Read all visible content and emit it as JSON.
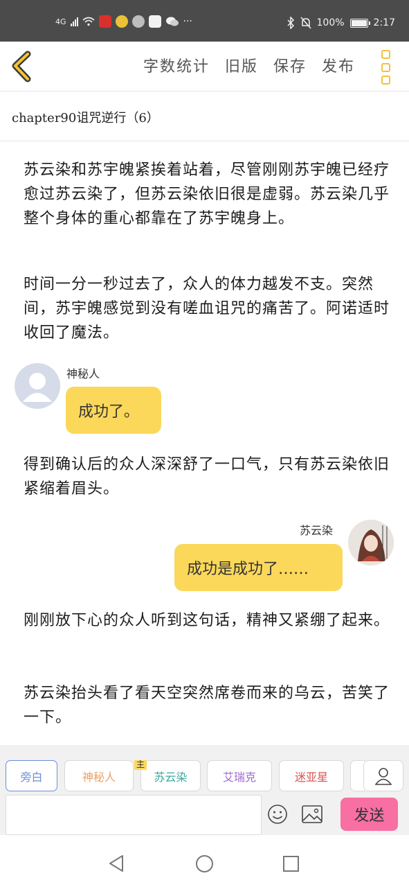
{
  "status_bar": {
    "network": "4G",
    "battery_text": "100%",
    "battery_level": 1.0,
    "time": "2:17",
    "more_dots": "···"
  },
  "toolbar": {
    "actions": [
      "字数统计",
      "旧版",
      "保存",
      "发布"
    ]
  },
  "chapter": {
    "title": "chapter90诅咒逆行（6）"
  },
  "content": {
    "para1": "苏云染和苏宇魄紧挨着站着，尽管刚刚苏宇魄已经疗愈过苏云染了，但苏云染依旧很是虚弱。苏云染几乎整个身体的重心都靠在了苏宇魄身上。",
    "para2": "时间一分一秒过去了，众人的体力越发不支。突然间，苏宇魄感觉到没有嗟血诅咒的痛苦了。阿诺适时收回了魔法。",
    "dialog1": {
      "speaker": "神秘人",
      "text": "成功了。"
    },
    "para3": "得到确认后的众人深深舒了一口气，只有苏云染依旧紧缩着眉头。",
    "dialog2": {
      "speaker": "苏云染",
      "text": "成功是成功了……"
    },
    "para4": "刚刚放下心的众人听到这句话，精神又紧绷了起来。",
    "para5": "苏云染抬头看了看天空突然席卷而来的乌云，苦笑了一下。"
  },
  "composer": {
    "roles": [
      {
        "label": "旁白",
        "color": "#6c8fd6"
      },
      {
        "label": "神秘人",
        "color": "#e9a36a"
      },
      {
        "label": "苏云染",
        "color": "#3aa8a0",
        "badge": "主"
      },
      {
        "label": "艾瑞克",
        "color": "#a06ad0"
      },
      {
        "label": "迷亚星",
        "color": "#d9534f"
      }
    ],
    "send_label": "发送",
    "accent": "#fbd85a",
    "send_color": "#f76fa3"
  }
}
